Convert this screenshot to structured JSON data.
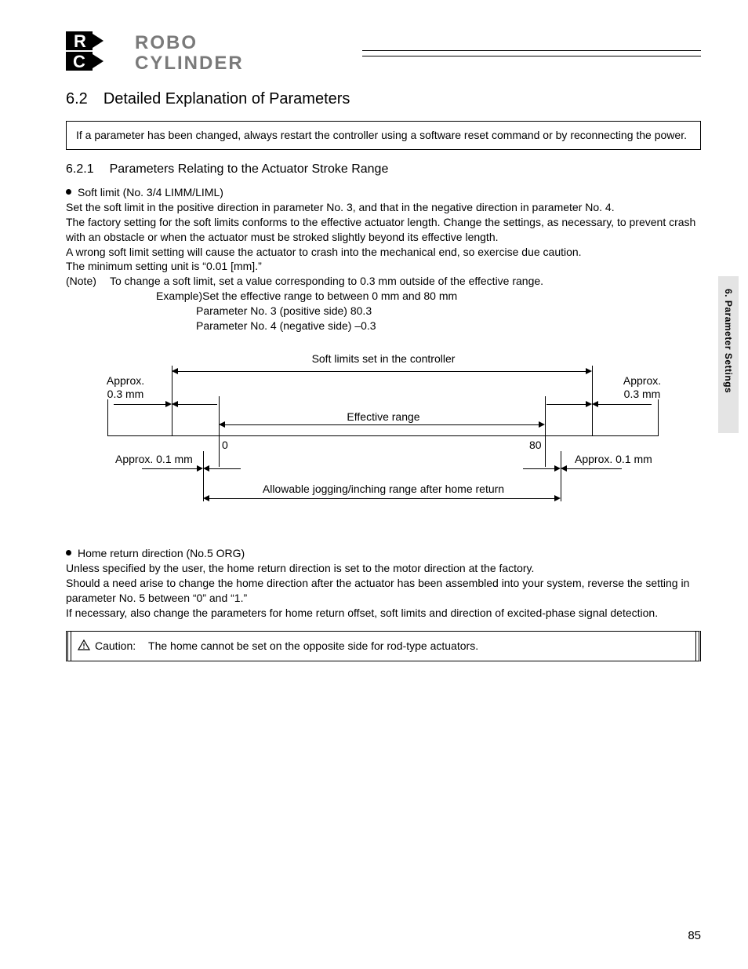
{
  "logo": {
    "line1": "ROBO",
    "line2": "CYLINDER"
  },
  "section": {
    "number": "6.2",
    "title": "Detailed Explanation of Parameters"
  },
  "intro_box": "If a parameter has been changed, always restart the controller using a software reset command or by reconnecting the power.",
  "subsection": {
    "number": "6.2.1",
    "title": "Parameters Relating to the Actuator Stroke Range"
  },
  "soft_limit": {
    "bullet": "Soft limit (No. 3/4 LIMM/LIML)",
    "p1": "Set the soft limit in the positive direction in parameter No. 3, and that in the negative direction in parameter No. 4.",
    "p2": "The factory setting for the soft limits conforms to the effective actuator length. Change the settings, as necessary, to prevent crash with an obstacle or when the actuator must be stroked slightly beyond its effective length.",
    "p3": "A wrong soft limit setting will cause the actuator to crash into the mechanical end, so exercise due caution.",
    "p4": "The minimum setting unit is “0.01 [mm].”",
    "note_label": "(Note)",
    "note": "To change a soft limit, set a value corresponding to 0.3 mm outside of the effective range.",
    "example_label": "Example)",
    "example": "Set the effective range to between 0 mm and 80 mm",
    "param3": "Parameter No. 3 (positive side) 80.3",
    "param4": "Parameter No. 4 (negative side) –0.3"
  },
  "diagram": {
    "top_label": "Soft limits set in the controller",
    "approx_left": "Approx.\n0.3 mm",
    "approx_right": "Approx.\n0.3 mm",
    "effective": "Effective range",
    "axis_left": "0",
    "axis_right": "80",
    "lower_left": "Approx. 0.1 mm",
    "lower_right": "Approx. 0.1 mm",
    "jog": "Allowable jogging/inching range after home return"
  },
  "home_return": {
    "bullet": "Home return direction (No.5 ORG)",
    "p1": "Unless specified by the user, the home return direction is set to the motor direction at the factory.",
    "p2": "Should a need arise to change the home direction after the actuator has been assembled into your system, reverse the setting in parameter No. 5 between “0” and “1.”",
    "p3": "If necessary, also change the parameters for home return offset, soft limits and direction of excited-phase signal detection."
  },
  "caution": {
    "label": "Caution:",
    "text": "The home cannot be set on the opposite side for rod-type actuators."
  },
  "side_tab": "6. Parameter Settings",
  "page_number": "85"
}
